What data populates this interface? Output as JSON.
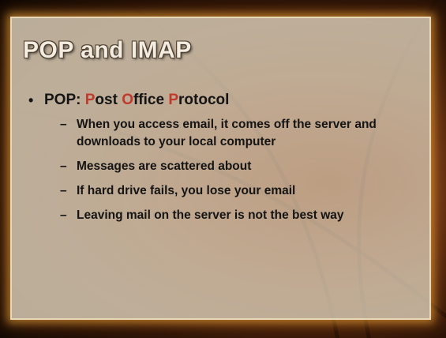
{
  "slide": {
    "title": "POP and IMAP",
    "bullet": {
      "label": "POP: ",
      "expansion": [
        {
          "initial": "P",
          "rest": "ost "
        },
        {
          "initial": "O",
          "rest": "ffice "
        },
        {
          "initial": "P",
          "rest": "rotocol"
        }
      ]
    },
    "sub_items": [
      "When you access email, it comes off the server and downloads to your local computer",
      "Messages are scattered about",
      "If hard drive fails, you lose your email",
      "Leaving mail on the server is not the best way"
    ],
    "bullet_symbol": "•",
    "dash_symbol": "–",
    "colors": {
      "accent": "#c0392b",
      "text": "#141414",
      "title": "#f3ece0",
      "panel": "#d6c8b2",
      "glow": "#f0aa3c"
    }
  }
}
